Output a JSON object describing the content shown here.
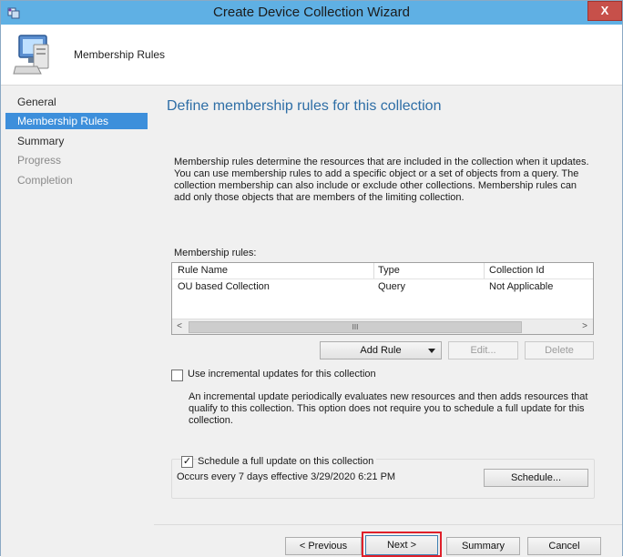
{
  "window": {
    "title": "Create Device Collection Wizard",
    "close_glyph": "X",
    "app_icon": "wizard-app-icon",
    "header_icon": "computer-icon",
    "header_title": "Membership Rules"
  },
  "nav": {
    "items": [
      {
        "label": "General",
        "state": "normal"
      },
      {
        "label": "Membership Rules",
        "state": "active"
      },
      {
        "label": "Summary",
        "state": "normal"
      },
      {
        "label": "Progress",
        "state": "disabled"
      },
      {
        "label": "Completion",
        "state": "disabled"
      }
    ]
  },
  "page": {
    "title": "Define membership rules for this collection",
    "description": "Membership rules determine the resources that are included in the collection when it updates. You can use membership rules to add a specific object or a set of objects from a query. The collection membership can also include or exclude other collections. Membership rules can add only those objects that are members of the limiting collection.",
    "rules_label": "Membership rules:"
  },
  "rules_table": {
    "columns": [
      "Rule Name",
      "Type",
      "Collection Id"
    ],
    "rows": [
      [
        "OU based Collection",
        "Query",
        "Not Applicable"
      ]
    ],
    "scroll_left": "<",
    "scroll_right": ">",
    "scroll_thumb": "III"
  },
  "rule_buttons": {
    "add": "Add Rule",
    "edit": "Edit...",
    "delete": "Delete"
  },
  "incremental": {
    "checked": false,
    "label": "Use incremental updates for this collection",
    "note": "An incremental update periodically evaluates new resources and then adds resources that qualify to this collection. This option does not require you to schedule a full update for this collection."
  },
  "full_update": {
    "checked": true,
    "check_glyph": "✓",
    "label": "Schedule a full update on this collection",
    "schedule_text": "Occurs every 7 days effective 3/29/2020 6:21 PM",
    "schedule_button": "Schedule..."
  },
  "footer": {
    "previous": "< Previous",
    "next": "Next >",
    "summary": "Summary",
    "cancel": "Cancel"
  },
  "colors": {
    "titlebar": "#5fb0e4",
    "nav_active": "#3d8fdb",
    "page_title": "#2e6ea6",
    "highlight": "#e0202a"
  }
}
